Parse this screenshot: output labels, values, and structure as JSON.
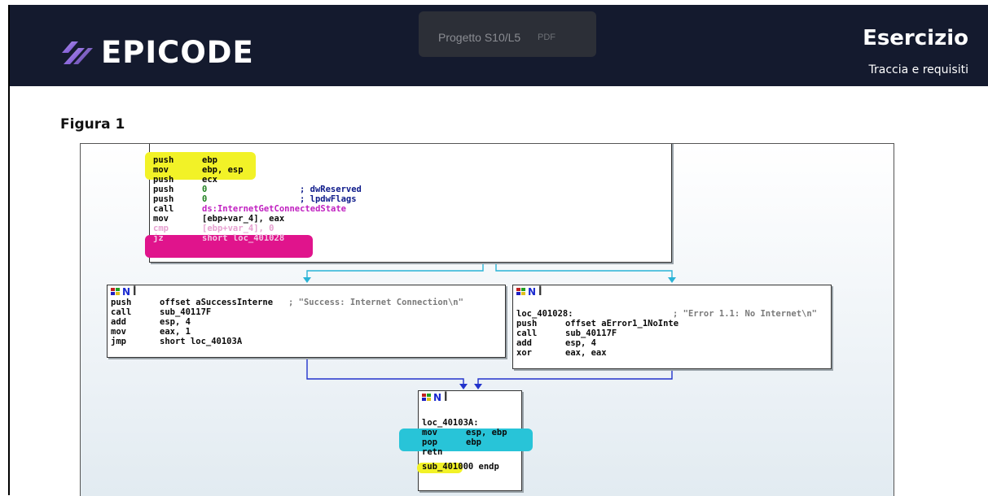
{
  "header": {
    "logo_text": "EPICODE",
    "tab_title": "Progetto S10/L5",
    "tab_sub": "PDF",
    "title": "Esercizio",
    "subtitle": "Traccia e requisiti"
  },
  "figure_label": "Figura 1",
  "colors": {
    "header_bg": "#141a2e",
    "highlight_yellow": "#f2f227",
    "highlight_magenta": "#e0148c",
    "highlight_cyan": "#28c4d8",
    "arrow_cyan": "#2ab3d6",
    "arrow_blue": "#2233cc"
  },
  "blocks": {
    "top": {
      "lines": [
        [
          "push",
          "ebp",
          ""
        ],
        [
          "mov",
          "ebp, esp",
          ""
        ],
        [
          "push",
          "ecx",
          ""
        ],
        [
          "push",
          "0",
          "; dwReserved"
        ],
        [
          "push",
          "0",
          "; lpdwFlags"
        ],
        [
          "call",
          "ds:InternetGetConnectedState",
          ""
        ],
        [
          "mov",
          "[ebp+var_4], eax",
          ""
        ],
        [
          "cmp",
          "[ebp+var_4], 0",
          ""
        ],
        [
          "jz",
          "short loc_401028",
          ""
        ]
      ]
    },
    "left": {
      "lines": [
        [
          "push",
          "offset aSuccessInterne",
          "; \"Success: Internet Connection\\n\""
        ],
        [
          "call",
          "sub_40117F",
          ""
        ],
        [
          "add",
          "esp, 4",
          ""
        ],
        [
          "mov",
          "eax, 1",
          ""
        ],
        [
          "jmp",
          "short loc_40103A",
          ""
        ]
      ]
    },
    "right": {
      "label": "loc_401028:",
      "label_comment": "; \"Error 1.1: No Internet\\n\"",
      "lines": [
        [
          "push",
          "offset aError1_1NoInte",
          ""
        ],
        [
          "call",
          "sub_40117F",
          ""
        ],
        [
          "add",
          "esp, 4",
          ""
        ],
        [
          "xor",
          "eax, eax",
          ""
        ]
      ]
    },
    "bottom": {
      "label": "loc_40103A:",
      "lines": [
        [
          "mov",
          "esp, ebp",
          ""
        ],
        [
          "pop",
          "ebp",
          ""
        ],
        [
          "retn",
          "",
          ""
        ]
      ],
      "endp": "sub_401000 endp"
    }
  }
}
